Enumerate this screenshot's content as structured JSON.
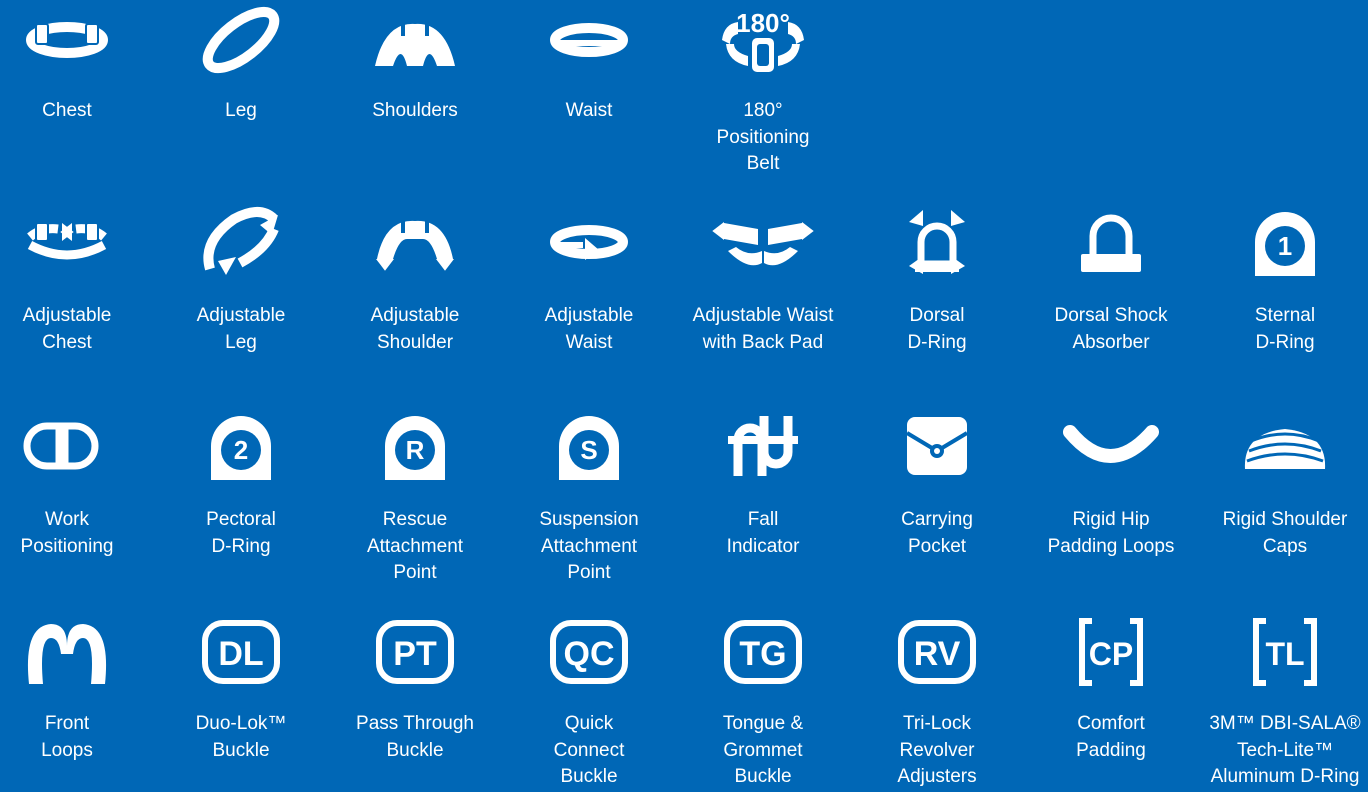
{
  "colors": {
    "background": "#0067b6",
    "foreground": "#ffffff"
  },
  "rows": [
    [
      {
        "icon": "chest-strap-icon",
        "label": "Chest"
      },
      {
        "icon": "leg-strap-icon",
        "label": "Leg"
      },
      {
        "icon": "shoulders-strap-icon",
        "label": "Shoulders"
      },
      {
        "icon": "waist-strap-icon",
        "label": "Waist"
      },
      {
        "icon": "positioning-belt-180-icon",
        "icon_text": "180°",
        "label": "180°\nPositioning\nBelt"
      }
    ],
    [
      {
        "icon": "adjustable-chest-icon",
        "label": "Adjustable\nChest"
      },
      {
        "icon": "adjustable-leg-icon",
        "label": "Adjustable\nLeg"
      },
      {
        "icon": "adjustable-shoulder-icon",
        "label": "Adjustable\nShoulder"
      },
      {
        "icon": "adjustable-waist-icon",
        "label": "Adjustable\nWaist"
      },
      {
        "icon": "adjustable-waist-back-pad-icon",
        "label": "Adjustable Waist\nwith Back Pad"
      },
      {
        "icon": "dorsal-d-ring-icon",
        "label": "Dorsal\nD-Ring"
      },
      {
        "icon": "dorsal-shock-absorber-icon",
        "label": "Dorsal Shock\nAbsorber"
      },
      {
        "icon": "sternal-d-ring-icon",
        "icon_text": "1",
        "label": "Sternal\nD-Ring"
      }
    ],
    [
      {
        "icon": "work-positioning-icon",
        "label": "Work\nPositioning"
      },
      {
        "icon": "pectoral-d-ring-icon",
        "icon_text": "2",
        "label": "Pectoral\nD-Ring"
      },
      {
        "icon": "rescue-attachment-icon",
        "icon_text": "R",
        "label": "Rescue\nAttachment\nPoint"
      },
      {
        "icon": "suspension-attachment-icon",
        "icon_text": "S",
        "label": "Suspension\nAttachment\nPoint"
      },
      {
        "icon": "fall-indicator-icon",
        "label": "Fall\nIndicator"
      },
      {
        "icon": "carrying-pocket-icon",
        "label": "Carrying\nPocket"
      },
      {
        "icon": "rigid-hip-padding-icon",
        "label": "Rigid Hip\nPadding Loops"
      },
      {
        "icon": "rigid-shoulder-caps-icon",
        "label": "Rigid Shoulder\nCaps"
      }
    ],
    [
      {
        "icon": "front-loops-icon",
        "label": "Front\nLoops"
      },
      {
        "icon": "duo-lok-buckle-icon",
        "icon_text": "DL",
        "label": "Duo-Lok™\nBuckle"
      },
      {
        "icon": "pass-through-buckle-icon",
        "icon_text": "PT",
        "label": "Pass Through\nBuckle"
      },
      {
        "icon": "quick-connect-buckle-icon",
        "icon_text": "QC",
        "label": "Quick\nConnect\nBuckle"
      },
      {
        "icon": "tongue-grommet-buckle-icon",
        "icon_text": "TG",
        "label": "Tongue &\nGrommet\nBuckle"
      },
      {
        "icon": "tri-lock-revolver-icon",
        "icon_text": "RV",
        "label": "Tri-Lock\nRevolver\nAdjusters"
      },
      {
        "icon": "comfort-padding-icon",
        "icon_text": "CP",
        "label": "Comfort\nPadding"
      },
      {
        "icon": "tech-lite-d-ring-icon",
        "icon_text": "TL",
        "label": "3M™ DBI-SALA®\nTech-Lite™\nAluminum D-Ring"
      }
    ]
  ]
}
